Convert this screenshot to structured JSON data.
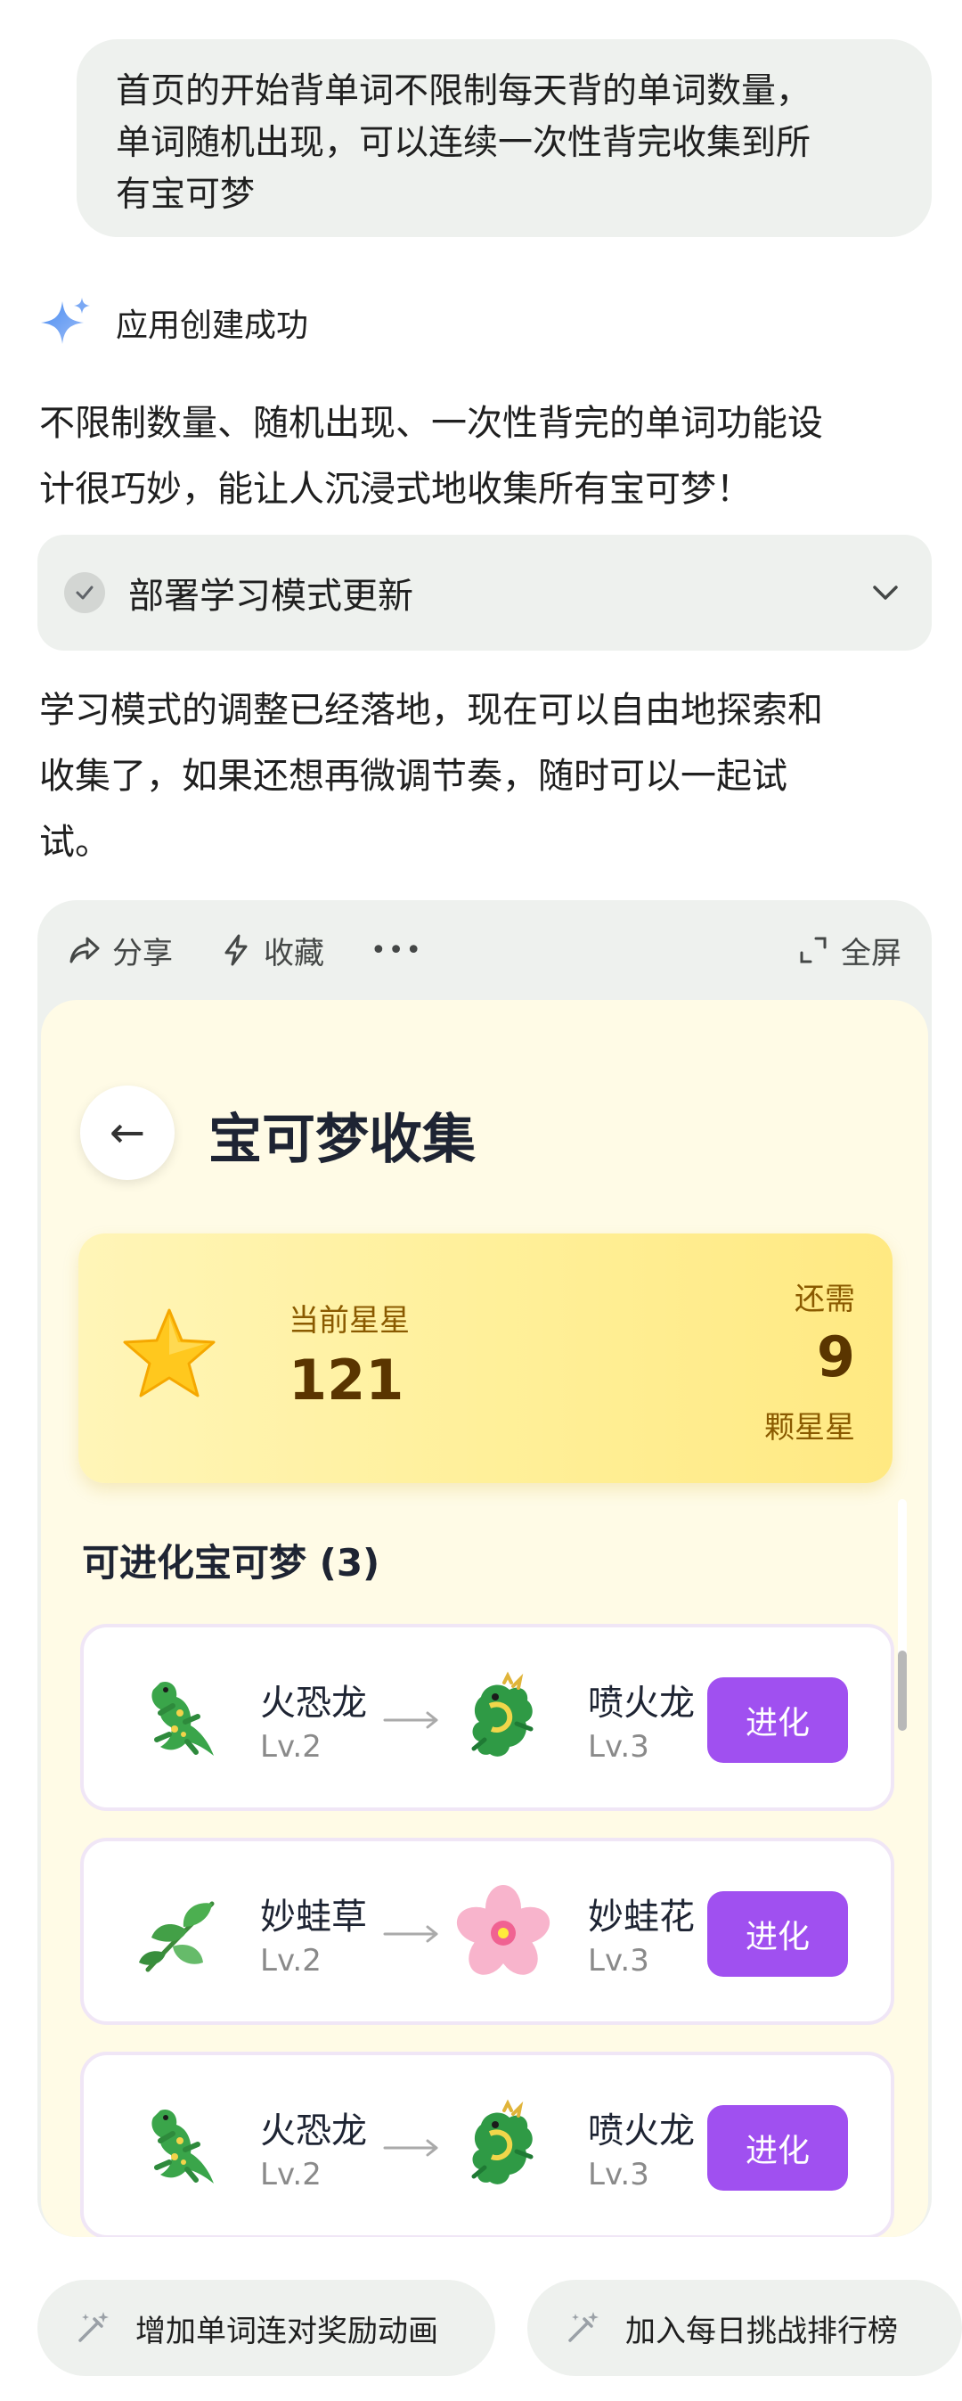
{
  "user_message": {
    "lines": [
      "首页的开始背单词不限制每天背的单词数量，",
      "单词随机出现，可以连续一次性背完收集到所",
      "有宝可梦"
    ]
  },
  "status": {
    "label": "应用创建成功"
  },
  "reply": {
    "paragraph1_lines": [
      "不限制数量、随机出现、一次性背完的单词功能设",
      "计很巧妙，能让人沉浸式地收集所有宝可梦！"
    ],
    "deploy_label": "部署学习模式更新",
    "paragraph2_lines": [
      "学习模式的调整已经落地，现在可以自由地探索和",
      "收集了，如果还想再微调节奏，随时可以一起试",
      "试。"
    ]
  },
  "card_toolbar": {
    "share": "分享",
    "collect": "收藏",
    "more": "•••",
    "fullscreen": "全屏"
  },
  "app": {
    "back": "←",
    "title": "宝可梦收集",
    "stars": {
      "current_label": "当前星星",
      "current_value": "121",
      "need_label": "还需",
      "need_value": "9",
      "need_unit": "颗星星"
    },
    "section_title": "可进化宝可梦 (3)",
    "evolutions": [
      {
        "from_icon": "lizard-icon",
        "from_name": "火恐龙",
        "from_level": "Lv.2",
        "to_icon": "dragon-icon",
        "to_name": "喷火龙",
        "to_level": "Lv.3",
        "button": "进化"
      },
      {
        "from_icon": "herb-icon",
        "from_name": "妙蛙草",
        "from_level": "Lv.2",
        "to_icon": "cherry-blossom-icon",
        "to_name": "妙蛙花",
        "to_level": "Lv.3",
        "button": "进化"
      },
      {
        "from_icon": "lizard-icon",
        "from_name": "火恐龙",
        "from_level": "Lv.2",
        "to_icon": "dragon-icon",
        "to_name": "喷火龙",
        "to_level": "Lv.3",
        "button": "进化"
      }
    ]
  },
  "suggestions": [
    "增加单词连对奖励动画",
    "加入每日挑战排行榜"
  ],
  "colors": {
    "accent_purple": "#a050f0",
    "star_panel": "#fff09a",
    "bubble_bg": "#eef1ee"
  }
}
